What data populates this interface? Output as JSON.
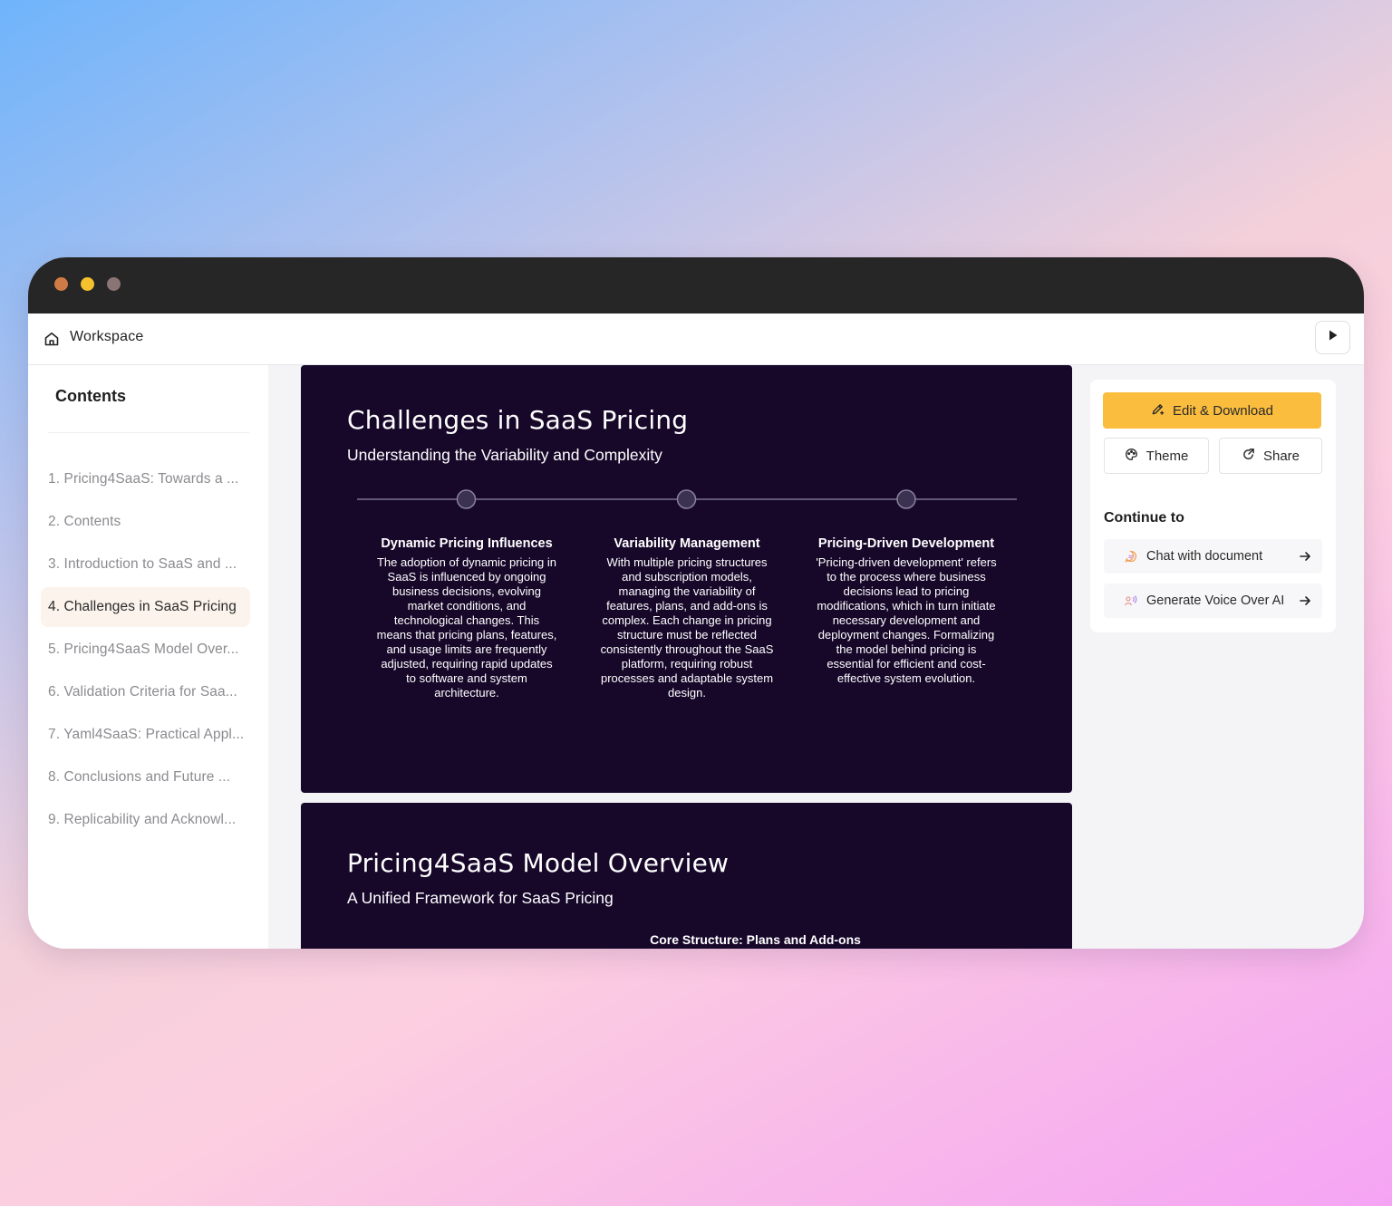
{
  "topbar": {
    "workspace_label": "Workspace"
  },
  "sidebar": {
    "title": "Contents",
    "items": [
      {
        "label": "1. Pricing4SaaS: Towards a ..."
      },
      {
        "label": "2. Contents"
      },
      {
        "label": "3. Introduction to SaaS and ..."
      },
      {
        "label": "4. Challenges in SaaS Pricing"
      },
      {
        "label": "5. Pricing4SaaS Model Over..."
      },
      {
        "label": "6. Validation Criteria for Saa..."
      },
      {
        "label": "7. Yaml4SaaS: Practical Appl..."
      },
      {
        "label": "8. Conclusions and Future ..."
      },
      {
        "label": "9. Replicability and Acknowl..."
      }
    ],
    "active_index": 3
  },
  "slides": {
    "slide1": {
      "title": "Challenges in SaaS Pricing",
      "subtitle": "Understanding the Variability and Complexity",
      "columns": [
        {
          "title": "Dynamic Pricing Influences",
          "body": "The adoption of dynamic pricing in SaaS is influenced by ongoing business decisions, evolving market conditions, and technological changes. This means that pricing plans, features, and usage limits are frequently adjusted, requiring rapid updates to software and system architecture."
        },
        {
          "title": "Variability Management",
          "body": "With multiple pricing structures and subscription models, managing the variability of features, plans, and add-ons is complex. Each change in pricing structure must be reflected consistently throughout the SaaS platform, requiring robust processes and adaptable system design."
        },
        {
          "title": "Pricing-Driven Development",
          "body": "'Pricing-driven development' refers to the process where business decisions lead to pricing modifications, which in turn initiate necessary development and deployment changes. Formalizing the model behind pricing is essential for efficient and cost-effective system evolution."
        }
      ]
    },
    "slide2": {
      "title": "Pricing4SaaS Model Overview",
      "subtitle": "A Unified Framework for SaaS Pricing",
      "section_label": "Core Structure: Plans and Add-ons"
    }
  },
  "panel": {
    "edit_download": "Edit & Download",
    "theme": "Theme",
    "share": "Share",
    "continue_title": "Continue to",
    "continue_items": [
      {
        "label": "Chat with document",
        "icon": "chat-bubble-icon"
      },
      {
        "label": "Generate Voice Over AI",
        "icon": "voice-wave-icon"
      }
    ]
  },
  "colors": {
    "slide_bg": "#17082a",
    "accent": "#fbbd3e",
    "titlebar": "#262626",
    "active_item_bg": "#fbf3ec"
  }
}
